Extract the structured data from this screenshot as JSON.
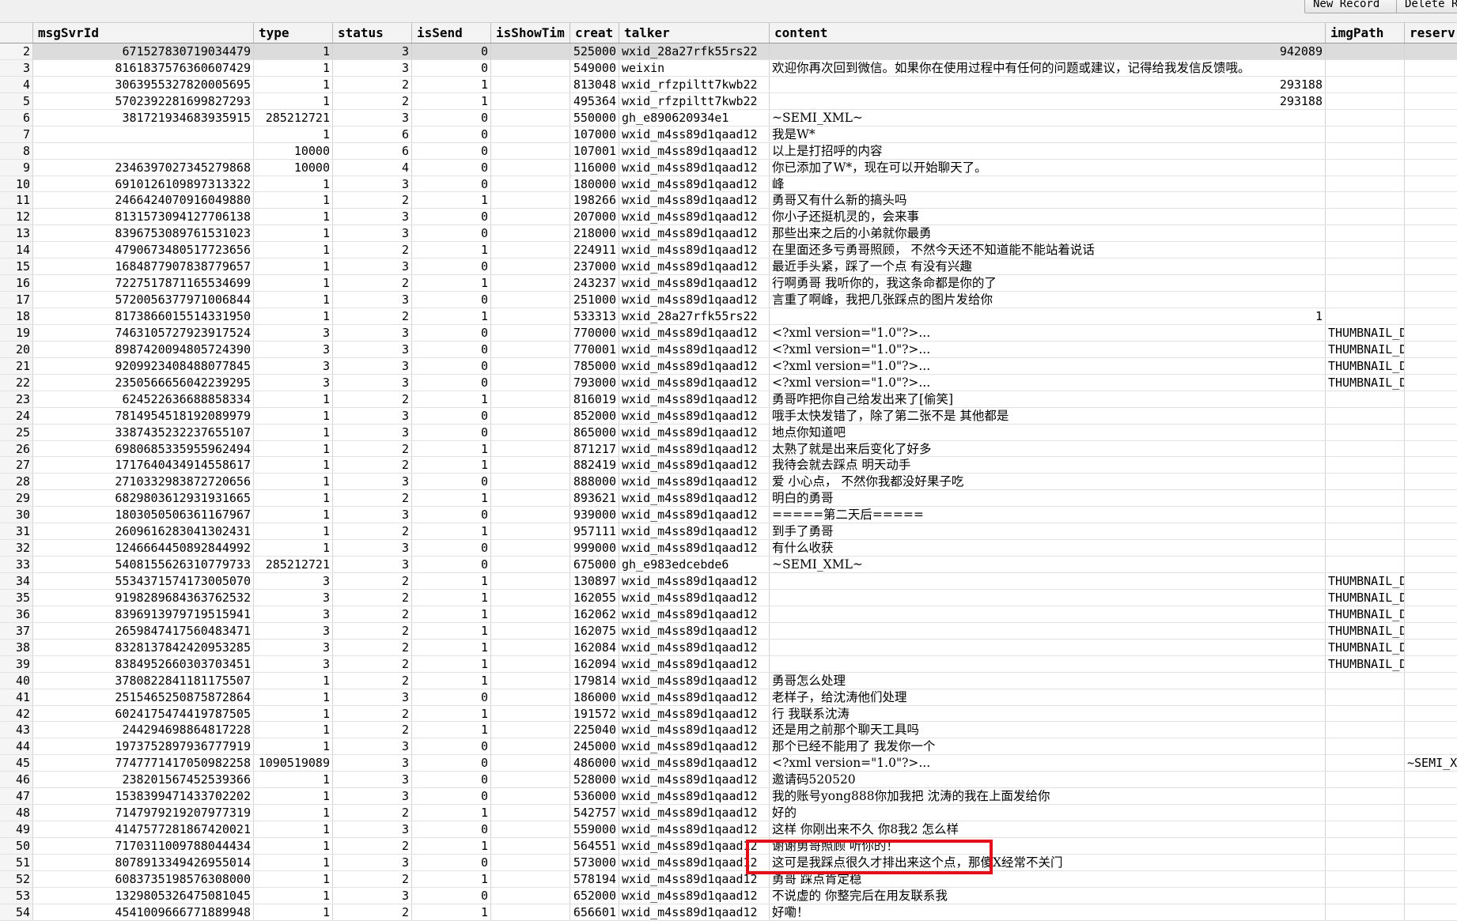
{
  "toolbar": {
    "new_record": "New Record",
    "delete_record": "Delete R"
  },
  "columns": [
    "msgSvrId",
    "type",
    "status",
    "isSend",
    "isShowTim",
    "creat",
    "talker",
    "content",
    "imgPath",
    "reserv"
  ],
  "rows": [
    {
      "n": "2",
      "msgSvrId": "671527830719034479",
      "type": "1",
      "status": "3",
      "isSend": "0",
      "creat": "525000",
      "talker": "wxid_28a27rfk55rs22",
      "content": "942089",
      "img": "",
      "res": ""
    },
    {
      "n": "3",
      "msgSvrId": "8161837576360607429",
      "type": "1",
      "status": "3",
      "isSend": "0",
      "creat": "549000",
      "talker": "weixin",
      "content": "欢迎你再次回到微信。如果你在使用过程中有任何的问题或建议，记得给我发信反馈哦。",
      "img": "",
      "res": ""
    },
    {
      "n": "4",
      "msgSvrId": "3063955327820005695",
      "type": "1",
      "status": "2",
      "isSend": "1",
      "creat": "813048",
      "talker": "wxid_rfzpiltt7kwb22",
      "content": "293188",
      "img": "",
      "res": ""
    },
    {
      "n": "5",
      "msgSvrId": "5702392281699827293",
      "type": "1",
      "status": "2",
      "isSend": "1",
      "creat": "495364",
      "talker": "wxid_rfzpiltt7kwb22",
      "content": "293188",
      "img": "",
      "res": ""
    },
    {
      "n": "6",
      "msgSvrId": "381721934683935915",
      "type": "285212721",
      "status": "3",
      "isSend": "0",
      "creat": "550000",
      "talker": "gh_e890620934e1",
      "content": "~SEMI_XML~",
      "img": "",
      "res": ""
    },
    {
      "n": "7",
      "msgSvrId": "",
      "type": "1",
      "status": "6",
      "isSend": "0",
      "creat": "107000",
      "talker": "wxid_m4ss89d1qaad12",
      "content": "我是W*",
      "img": "",
      "res": ""
    },
    {
      "n": "8",
      "msgSvrId": "",
      "type": "10000",
      "status": "6",
      "isSend": "0",
      "creat": "107001",
      "talker": "wxid_m4ss89d1qaad12",
      "content": "以上是打招呼的内容",
      "img": "",
      "res": ""
    },
    {
      "n": "9",
      "msgSvrId": "2346397027345279868",
      "type": "10000",
      "status": "4",
      "isSend": "0",
      "creat": "116000",
      "talker": "wxid_m4ss89d1qaad12",
      "content": "你已添加了W*，现在可以开始聊天了。",
      "img": "",
      "res": ""
    },
    {
      "n": "10",
      "msgSvrId": "6910126109897313322",
      "type": "1",
      "status": "3",
      "isSend": "0",
      "creat": "180000",
      "talker": "wxid_m4ss89d1qaad12",
      "content": "峰",
      "img": "",
      "res": ""
    },
    {
      "n": "11",
      "msgSvrId": "2466424070916049880",
      "type": "1",
      "status": "2",
      "isSend": "1",
      "creat": "198266",
      "talker": "wxid_m4ss89d1qaad12",
      "content": "勇哥又有什么新的搞头吗",
      "img": "",
      "res": ""
    },
    {
      "n": "12",
      "msgSvrId": "8131573094127706138",
      "type": "1",
      "status": "3",
      "isSend": "0",
      "creat": "207000",
      "talker": "wxid_m4ss89d1qaad12",
      "content": "你小子还挺机灵的，会来事",
      "img": "",
      "res": ""
    },
    {
      "n": "13",
      "msgSvrId": "8396753089761531023",
      "type": "1",
      "status": "3",
      "isSend": "0",
      "creat": "218000",
      "talker": "wxid_m4ss89d1qaad12",
      "content": "那些出来之后的小弟就你最勇",
      "img": "",
      "res": ""
    },
    {
      "n": "14",
      "msgSvrId": "4790673480517723656",
      "type": "1",
      "status": "2",
      "isSend": "1",
      "creat": "224911",
      "talker": "wxid_m4ss89d1qaad12",
      "content": "在里面还多亏勇哥照顾， 不然今天还不知道能不能站着说话",
      "img": "",
      "res": ""
    },
    {
      "n": "15",
      "msgSvrId": "1684877907838779657",
      "type": "1",
      "status": "3",
      "isSend": "0",
      "creat": "237000",
      "talker": "wxid_m4ss89d1qaad12",
      "content": "最近手头紧，踩了一个点 有没有兴趣",
      "img": "",
      "res": ""
    },
    {
      "n": "16",
      "msgSvrId": "7227517871165534699",
      "type": "1",
      "status": "2",
      "isSend": "1",
      "creat": "243237",
      "talker": "wxid_m4ss89d1qaad12",
      "content": "行啊勇哥 我听你的，我这条命都是你的了",
      "img": "",
      "res": ""
    },
    {
      "n": "17",
      "msgSvrId": "5720056377971006844",
      "type": "1",
      "status": "3",
      "isSend": "0",
      "creat": "251000",
      "talker": "wxid_m4ss89d1qaad12",
      "content": "言重了啊峰，我把几张踩点的图片发给你",
      "img": "",
      "res": ""
    },
    {
      "n": "18",
      "msgSvrId": "8173866015514331950",
      "type": "1",
      "status": "2",
      "isSend": "1",
      "creat": "533313",
      "talker": "wxid_28a27rfk55rs22",
      "content": "1",
      "img": "",
      "res": ""
    },
    {
      "n": "19",
      "msgSvrId": "7463105727923917524",
      "type": "3",
      "status": "3",
      "isSend": "0",
      "creat": "770000",
      "talker": "wxid_m4ss89d1qaad12",
      "content": "<?xml version=\"1.0\"?>...",
      "img": "THUMBNAIL_D",
      "res": ""
    },
    {
      "n": "20",
      "msgSvrId": "8987420094805724390",
      "type": "3",
      "status": "3",
      "isSend": "0",
      "creat": "770001",
      "talker": "wxid_m4ss89d1qaad12",
      "content": "<?xml version=\"1.0\"?>...",
      "img": "THUMBNAIL_D",
      "res": ""
    },
    {
      "n": "21",
      "msgSvrId": "9209923408488077845",
      "type": "3",
      "status": "3",
      "isSend": "0",
      "creat": "785000",
      "talker": "wxid_m4ss89d1qaad12",
      "content": "<?xml version=\"1.0\"?>...",
      "img": "THUMBNAIL_D",
      "res": ""
    },
    {
      "n": "22",
      "msgSvrId": "2350566656042239295",
      "type": "3",
      "status": "3",
      "isSend": "0",
      "creat": "793000",
      "talker": "wxid_m4ss89d1qaad12",
      "content": "<?xml version=\"1.0\"?>...",
      "img": "THUMBNAIL_D",
      "res": ""
    },
    {
      "n": "23",
      "msgSvrId": "624522636688858334",
      "type": "1",
      "status": "2",
      "isSend": "1",
      "creat": "816019",
      "talker": "wxid_m4ss89d1qaad12",
      "content": "勇哥咋把你自己给发出来了[偷笑]",
      "img": "",
      "res": ""
    },
    {
      "n": "24",
      "msgSvrId": "7814954518192089979",
      "type": "1",
      "status": "3",
      "isSend": "0",
      "creat": "852000",
      "talker": "wxid_m4ss89d1qaad12",
      "content": "哦手太快发错了，除了第二张不是 其他都是",
      "img": "",
      "res": ""
    },
    {
      "n": "25",
      "msgSvrId": "3387435232237655107",
      "type": "1",
      "status": "3",
      "isSend": "0",
      "creat": "865000",
      "talker": "wxid_m4ss89d1qaad12",
      "content": "地点你知道吧",
      "img": "",
      "res": ""
    },
    {
      "n": "26",
      "msgSvrId": "6980685335955962494",
      "type": "1",
      "status": "2",
      "isSend": "1",
      "creat": "871217",
      "talker": "wxid_m4ss89d1qaad12",
      "content": "太熟了就是出来后变化了好多",
      "img": "",
      "res": ""
    },
    {
      "n": "27",
      "msgSvrId": "1717640434914558617",
      "type": "1",
      "status": "2",
      "isSend": "1",
      "creat": "882419",
      "talker": "wxid_m4ss89d1qaad12",
      "content": "我待会就去踩点 明天动手",
      "img": "",
      "res": ""
    },
    {
      "n": "28",
      "msgSvrId": "2710332983872720656",
      "type": "1",
      "status": "3",
      "isSend": "0",
      "creat": "888000",
      "talker": "wxid_m4ss89d1qaad12",
      "content": "爱 小心点， 不然你我都没好果子吃",
      "img": "",
      "res": ""
    },
    {
      "n": "29",
      "msgSvrId": "6829803612931931665",
      "type": "1",
      "status": "2",
      "isSend": "1",
      "creat": "893621",
      "talker": "wxid_m4ss89d1qaad12",
      "content": "明白的勇哥",
      "img": "",
      "res": ""
    },
    {
      "n": "30",
      "msgSvrId": "1803050506361167967",
      "type": "1",
      "status": "3",
      "isSend": "0",
      "creat": "939000",
      "talker": "wxid_m4ss89d1qaad12",
      "content": "=====第二天后=====",
      "img": "",
      "res": ""
    },
    {
      "n": "31",
      "msgSvrId": "2609616283041302431",
      "type": "1",
      "status": "2",
      "isSend": "1",
      "creat": "957111",
      "talker": "wxid_m4ss89d1qaad12",
      "content": "到手了勇哥",
      "img": "",
      "res": ""
    },
    {
      "n": "32",
      "msgSvrId": "1246664450892844992",
      "type": "1",
      "status": "3",
      "isSend": "0",
      "creat": "999000",
      "talker": "wxid_m4ss89d1qaad12",
      "content": "有什么收获",
      "img": "",
      "res": ""
    },
    {
      "n": "33",
      "msgSvrId": "5408155626310779733",
      "type": "285212721",
      "status": "3",
      "isSend": "0",
      "creat": "675000",
      "talker": "gh_e983edcebde6",
      "content": "~SEMI_XML~",
      "img": "",
      "res": ""
    },
    {
      "n": "34",
      "msgSvrId": "5534371574173005070",
      "type": "3",
      "status": "2",
      "isSend": "1",
      "creat": "130897",
      "talker": "wxid_m4ss89d1qaad12",
      "content": "",
      "img": "THUMBNAIL_D",
      "res": ""
    },
    {
      "n": "35",
      "msgSvrId": "9198289684363762532",
      "type": "3",
      "status": "2",
      "isSend": "1",
      "creat": "162055",
      "talker": "wxid_m4ss89d1qaad12",
      "content": "",
      "img": "THUMBNAIL_D",
      "res": ""
    },
    {
      "n": "36",
      "msgSvrId": "8396913979719515941",
      "type": "3",
      "status": "2",
      "isSend": "1",
      "creat": "162062",
      "talker": "wxid_m4ss89d1qaad12",
      "content": "",
      "img": "THUMBNAIL_D",
      "res": ""
    },
    {
      "n": "37",
      "msgSvrId": "2659847417560483471",
      "type": "3",
      "status": "2",
      "isSend": "1",
      "creat": "162075",
      "talker": "wxid_m4ss89d1qaad12",
      "content": "",
      "img": "THUMBNAIL_D",
      "res": ""
    },
    {
      "n": "38",
      "msgSvrId": "8328137842420953285",
      "type": "3",
      "status": "2",
      "isSend": "1",
      "creat": "162084",
      "talker": "wxid_m4ss89d1qaad12",
      "content": "",
      "img": "THUMBNAIL_D",
      "res": ""
    },
    {
      "n": "39",
      "msgSvrId": "8384952660303703451",
      "type": "3",
      "status": "2",
      "isSend": "1",
      "creat": "162094",
      "talker": "wxid_m4ss89d1qaad12",
      "content": "",
      "img": "THUMBNAIL_D",
      "res": ""
    },
    {
      "n": "40",
      "msgSvrId": "3780822841181175507",
      "type": "1",
      "status": "2",
      "isSend": "1",
      "creat": "179814",
      "talker": "wxid_m4ss89d1qaad12",
      "content": "勇哥怎么处理",
      "img": "",
      "res": ""
    },
    {
      "n": "41",
      "msgSvrId": "2515465250875872864",
      "type": "1",
      "status": "3",
      "isSend": "0",
      "creat": "186000",
      "talker": "wxid_m4ss89d1qaad12",
      "content": "老样子，给沈涛他们处理",
      "img": "",
      "res": ""
    },
    {
      "n": "42",
      "msgSvrId": "6024175474419787505",
      "type": "1",
      "status": "2",
      "isSend": "1",
      "creat": "191572",
      "talker": "wxid_m4ss89d1qaad12",
      "content": "行 我联系沈涛",
      "img": "",
      "res": ""
    },
    {
      "n": "43",
      "msgSvrId": "244294698864817228",
      "type": "1",
      "status": "2",
      "isSend": "1",
      "creat": "225040",
      "talker": "wxid_m4ss89d1qaad12",
      "content": "还是用之前那个聊天工具吗",
      "img": "",
      "res": ""
    },
    {
      "n": "44",
      "msgSvrId": "1973752897936777919",
      "type": "1",
      "status": "3",
      "isSend": "0",
      "creat": "245000",
      "talker": "wxid_m4ss89d1qaad12",
      "content": "那个已经不能用了 我发你一个",
      "img": "",
      "res": ""
    },
    {
      "n": "45",
      "msgSvrId": "7747771417050982258",
      "type": "1090519089",
      "status": "3",
      "isSend": "0",
      "creat": "486000",
      "talker": "wxid_m4ss89d1qaad12",
      "content": "<?xml version=\"1.0\"?>...",
      "img": "",
      "res": "~SEMI_X"
    },
    {
      "n": "46",
      "msgSvrId": "238201567452539366",
      "type": "1",
      "status": "3",
      "isSend": "0",
      "creat": "528000",
      "talker": "wxid_m4ss89d1qaad12",
      "content": "邀请码520520",
      "img": "",
      "res": ""
    },
    {
      "n": "47",
      "msgSvrId": "1538399471433702202",
      "type": "1",
      "status": "3",
      "isSend": "0",
      "creat": "536000",
      "talker": "wxid_m4ss89d1qaad12",
      "content": "我的账号yong888你加我把 沈涛的我在上面发给你",
      "img": "",
      "res": ""
    },
    {
      "n": "48",
      "msgSvrId": "7147979219207977319",
      "type": "1",
      "status": "2",
      "isSend": "1",
      "creat": "542757",
      "talker": "wxid_m4ss89d1qaad12",
      "content": "好的",
      "img": "",
      "res": ""
    },
    {
      "n": "49",
      "msgSvrId": "4147577281867420021",
      "type": "1",
      "status": "3",
      "isSend": "0",
      "creat": "559000",
      "talker": "wxid_m4ss89d1qaad12",
      "content": "这样 你刚出来不久 你8我2 怎么样",
      "img": "",
      "res": ""
    },
    {
      "n": "50",
      "msgSvrId": "7170311009788044434",
      "type": "1",
      "status": "2",
      "isSend": "1",
      "creat": "564551",
      "talker": "wxid_m4ss89d1qaad12",
      "content": "谢谢勇哥照顾 听你的！",
      "img": "",
      "res": ""
    },
    {
      "n": "51",
      "msgSvrId": "8078913349426955014",
      "type": "1",
      "status": "3",
      "isSend": "0",
      "creat": "573000",
      "talker": "wxid_m4ss89d1qaad12",
      "content": "这可是我踩点很久才排出来这个点，那傻X经常不关门",
      "img": "",
      "res": ""
    },
    {
      "n": "52",
      "msgSvrId": "6083735198576308000",
      "type": "1",
      "status": "2",
      "isSend": "1",
      "creat": "578194",
      "talker": "wxid_m4ss89d1qaad12",
      "content": "勇哥 踩点肯定稳",
      "img": "",
      "res": ""
    },
    {
      "n": "53",
      "msgSvrId": "1329805326475081045",
      "type": "1",
      "status": "3",
      "isSend": "0",
      "creat": "652000",
      "talker": "wxid_m4ss89d1qaad12",
      "content": "不说虚的 你整完后在用友联系我",
      "img": "",
      "res": ""
    },
    {
      "n": "54",
      "msgSvrId": "4541009666771889948",
      "type": "1",
      "status": "2",
      "isSend": "1",
      "creat": "656601",
      "talker": "wxid_m4ss89d1qaad12",
      "content": "好嘞！",
      "img": "",
      "res": ""
    }
  ]
}
